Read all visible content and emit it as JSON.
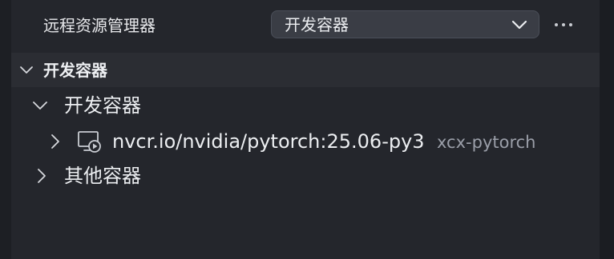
{
  "header": {
    "title": "远程资源管理器",
    "dropdown_value": "开发容器",
    "more_icon": "ellipsis-icon"
  },
  "section": {
    "title": "开发容器",
    "expanded": true
  },
  "tree": {
    "group_dev": {
      "label": "开发容器",
      "expanded": true
    },
    "container": {
      "label": "nvcr.io/nvidia/pytorch:25.06-py3",
      "description": "xcx-pytorch",
      "icon": "container-play-icon",
      "expanded": false
    },
    "group_other": {
      "label": "其他容器",
      "expanded": false
    }
  },
  "colors": {
    "panel_bg": "#24262c",
    "section_bg": "#2b2d33",
    "dropdown_bg": "#3a3d45",
    "text": "#eceef1",
    "muted_text": "#9a9ea8"
  }
}
